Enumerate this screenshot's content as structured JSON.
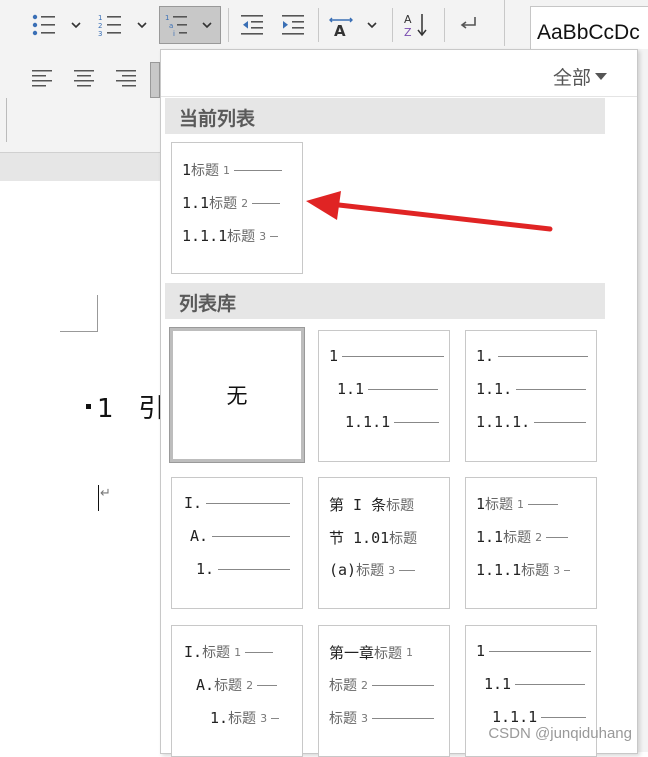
{
  "ribbon": {
    "styles_preview": "AaBbCcDc",
    "buttons": {
      "bullets": "bullets-icon",
      "numbering": "numbering-icon",
      "multilevel": "multilevel-list-icon",
      "decrease_indent": "decrease-indent-icon",
      "increase_indent": "increase-indent-icon",
      "text_direction": "text-direction-icon",
      "sort": "sort-icon",
      "show_marks": "show-hide-marks-icon",
      "align_left": "align-left-icon",
      "align_center": "align-center-icon",
      "align_right": "align-right-icon"
    }
  },
  "document": {
    "heading_number": "1",
    "heading_text": "引"
  },
  "dropdown": {
    "filter_label": "全部",
    "current_section": "当前列表",
    "library_section": "列表库",
    "current_list": {
      "rows": [
        {
          "num": "1",
          "label": "标题",
          "level": "1"
        },
        {
          "num": "1.1",
          "label": "标题",
          "level": "2"
        },
        {
          "num": "1.1.1",
          "label": "标题",
          "level": "3"
        }
      ]
    },
    "library": [
      {
        "type": "none",
        "label": "无"
      },
      {
        "rows": [
          {
            "num": "1"
          },
          {
            "num": "1.1"
          },
          {
            "num": "1.1.1"
          }
        ]
      },
      {
        "rows": [
          {
            "num": "1."
          },
          {
            "num": "1.1."
          },
          {
            "num": "1.1.1."
          }
        ]
      },
      {
        "rows": [
          {
            "num": "I."
          },
          {
            "num": "A."
          },
          {
            "num": "1."
          }
        ]
      },
      {
        "rows": [
          {
            "num": "第 I 条",
            "label": "标题"
          },
          {
            "num": "节 1.01",
            "label": "标题"
          },
          {
            "num": "(a)",
            "label": "标题",
            "level": "3"
          }
        ]
      },
      {
        "rows": [
          {
            "num": "1",
            "label": "标题",
            "level": "1"
          },
          {
            "num": "1.1",
            "label": "标题",
            "level": "2"
          },
          {
            "num": "1.1.1",
            "label": "标题",
            "level": "3"
          }
        ]
      },
      {
        "rows": [
          {
            "num": "I.",
            "label": "标题",
            "level": "1"
          },
          {
            "num": "A.",
            "label": "标题",
            "level": "2"
          },
          {
            "num": "1.",
            "label": "标题",
            "level": "3"
          }
        ]
      },
      {
        "rows": [
          {
            "num": "第一章",
            "label": "标题",
            "level": "1"
          },
          {
            "num": "",
            "label": "标题",
            "level": "2"
          },
          {
            "num": "",
            "label": "标题",
            "level": "3"
          }
        ]
      },
      {
        "rows": [
          {
            "num": "1"
          },
          {
            "num": "1.1"
          },
          {
            "num": "1.1.1"
          }
        ]
      }
    ]
  },
  "annotation": {
    "arrow_color": "#e02424"
  },
  "watermark": "CSDN @junqiduhang"
}
